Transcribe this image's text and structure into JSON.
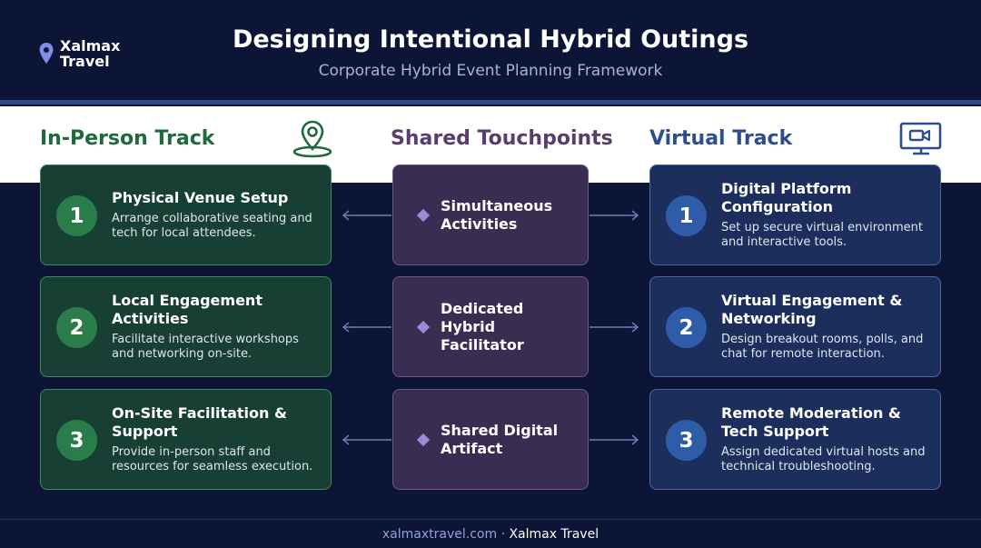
{
  "header": {
    "logo_line1": "Xalmax",
    "logo_line2": "Travel",
    "title": "Designing Intentional Hybrid Outings",
    "subtitle": "Corporate Hybrid Event Planning Framework"
  },
  "columns": {
    "left_heading": "In-Person Track",
    "mid_heading": "Shared Touchpoints",
    "right_heading": "Virtual Track"
  },
  "left": [
    {
      "num": "1",
      "title": "Physical Venue Setup",
      "desc": "Arrange collaborative seating and tech for local attendees."
    },
    {
      "num": "2",
      "title": "Local Engagement Activities",
      "desc": "Facilitate interactive workshops and networking on-site."
    },
    {
      "num": "3",
      "title": "On-Site Facilitation & Support",
      "desc": "Provide in-person staff and resources for seamless execution."
    }
  ],
  "mid": [
    {
      "title": "Simultaneous Activities"
    },
    {
      "title": "Dedicated Hybrid Facilitator"
    },
    {
      "title": "Shared Digital Artifact"
    }
  ],
  "right": [
    {
      "num": "1",
      "title": "Digital Platform Configuration",
      "desc": "Set up secure virtual environment and interactive tools."
    },
    {
      "num": "2",
      "title": "Virtual Engagement & Networking",
      "desc": "Design breakout rooms, polls, and chat for remote interaction."
    },
    {
      "num": "3",
      "title": "Remote Moderation & Tech Support",
      "desc": "Assign dedicated virtual hosts and technical troubleshooting."
    }
  ],
  "footer": {
    "url": "xalmaxtravel.com",
    "separator": "·",
    "brand": "Xalmax Travel"
  },
  "colors": {
    "background": "#0c1535",
    "in_person_accent": "#2a7d4a",
    "virtual_accent": "#2f5ca8",
    "shared_accent": "#9d8ad6"
  },
  "icons": {
    "logo": "location-pin-icon",
    "in_person": "map-pin-icon",
    "virtual": "monitor-video-icon",
    "shared": "diamond-icon"
  }
}
